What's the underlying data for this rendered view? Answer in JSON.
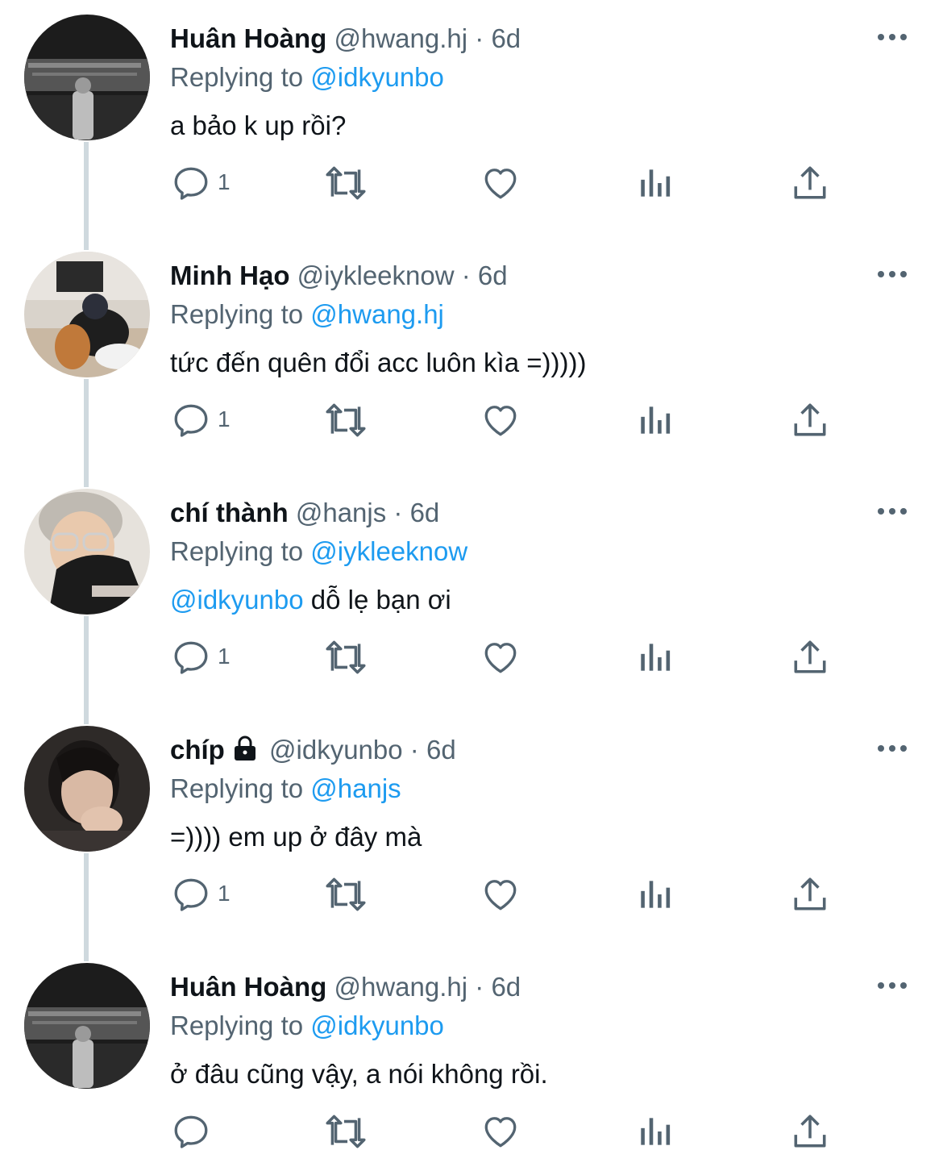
{
  "tweets": [
    {
      "display_name": "Huân Hoàng",
      "handle": "@hwang.hj",
      "dot": "·",
      "time": "6d",
      "replying_label": "Replying to",
      "replying_to": "@idkyunbo",
      "text_mention": "",
      "text": "a bảo k up rồi?",
      "reply_count": "1",
      "locked": false
    },
    {
      "display_name": "Minh Hạo",
      "handle": "@iykleeknow",
      "dot": "·",
      "time": "6d",
      "replying_label": "Replying to",
      "replying_to": "@hwang.hj",
      "text_mention": "",
      "text": "tức đến quên đổi acc luôn kìa =)))))",
      "reply_count": "1",
      "locked": false
    },
    {
      "display_name": "chí thành",
      "handle": "@hanjs",
      "dot": "·",
      "time": "6d",
      "replying_label": "Replying to",
      "replying_to": "@iykleeknow",
      "text_mention": "@idkyunbo",
      "text": " dỗ lẹ bạn ơi",
      "reply_count": "1",
      "locked": false
    },
    {
      "display_name": "chíp",
      "handle": "@idkyunbo",
      "dot": "·",
      "time": "6d",
      "replying_label": "Replying to",
      "replying_to": "@hanjs",
      "text_mention": "",
      "text": "=)))) em up ở đây mà",
      "reply_count": "1",
      "locked": true
    },
    {
      "display_name": "Huân Hoàng",
      "handle": "@hwang.hj",
      "dot": "·",
      "time": "6d",
      "replying_label": "Replying to",
      "replying_to": "@idkyunbo",
      "text_mention": "",
      "text": "ở đâu cũng vậy, a nói không rồi.",
      "reply_count": "",
      "locked": false
    }
  ],
  "icons": {
    "reply": "reply-icon",
    "retweet": "retweet-icon",
    "like": "heart-icon",
    "views": "views-icon",
    "share": "share-icon",
    "more": "more-options-icon",
    "lock": "lock-icon"
  },
  "colors": {
    "text": "#0f1419",
    "secondary": "#536471",
    "mention": "#1d9bf0",
    "thread_line": "#cfd9de"
  }
}
